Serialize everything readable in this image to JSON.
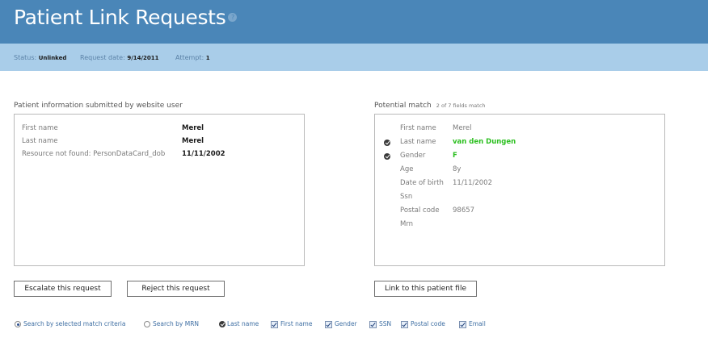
{
  "header": {
    "title": "Patient Link Requests",
    "help_icon": "question-circle-icon"
  },
  "status": {
    "status_label": "Status:",
    "status_value": "Unlinked",
    "request_date_label": "Request date:",
    "request_date_value": "9/14/2011",
    "attempt_label": "Attempt:",
    "attempt_value": "1"
  },
  "left_panel": {
    "heading": "Patient information submitted by website user",
    "rows": [
      {
        "label": "First name",
        "value": "Merel"
      },
      {
        "label": "Last name",
        "value": "Merel"
      },
      {
        "label": "Resource not found: PersonDataCard_dob",
        "value": "11/11/2002"
      }
    ]
  },
  "right_panel": {
    "heading": "Potential match",
    "match_summary": "2 of 7 fields match",
    "rows": [
      {
        "label": "First name",
        "value": "Merel",
        "matched": false
      },
      {
        "label": "Last name",
        "value": "van den Dungen",
        "matched": true
      },
      {
        "label": "Gender",
        "value": "F",
        "matched": true
      },
      {
        "label": "Age",
        "value": "8y",
        "matched": false
      },
      {
        "label": "Date of birth",
        "value": "11/11/2002",
        "matched": false
      },
      {
        "label": "Ssn",
        "value": "",
        "matched": false
      },
      {
        "label": "Postal code",
        "value": "98657",
        "matched": false
      },
      {
        "label": "Mrn",
        "value": "",
        "matched": false
      }
    ]
  },
  "buttons": {
    "escalate": "Escalate this request",
    "reject": "Reject this request",
    "link": "Link to this patient file"
  },
  "search_options": {
    "radio_criteria": "Search by selected match criteria",
    "radio_mrn": "Search by MRN",
    "selected_radio": "criteria",
    "criteria": [
      {
        "label": "Last name",
        "kind": "fixed"
      },
      {
        "label": "First name",
        "kind": "checkbox",
        "checked": true
      },
      {
        "label": "Gender",
        "kind": "checkbox",
        "checked": true
      },
      {
        "label": "SSN",
        "kind": "checkbox",
        "checked": true
      },
      {
        "label": "Postal code",
        "kind": "checkbox",
        "checked": true
      },
      {
        "label": "Email",
        "kind": "checkbox",
        "checked": true
      }
    ]
  },
  "colors": {
    "header_bg": "#4a86b8",
    "status_bg": "#a9cde9",
    "match_green": "#2bbf1f"
  }
}
